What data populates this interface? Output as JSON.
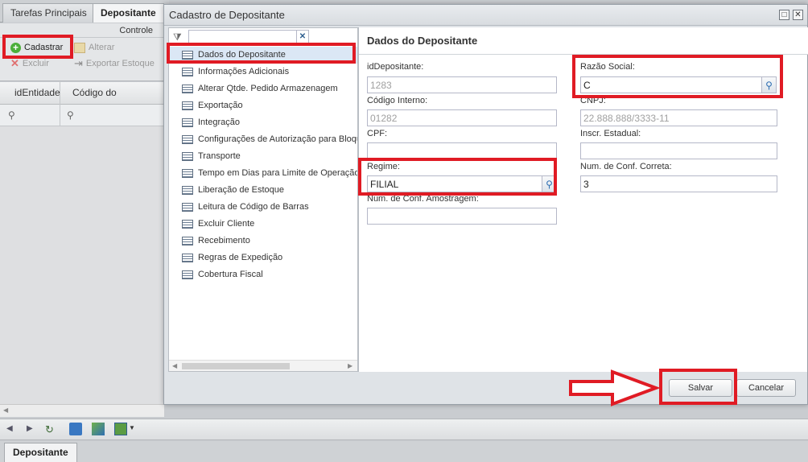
{
  "tabs": [
    {
      "label": "Tarefas Principais"
    },
    {
      "label": "Depositante"
    }
  ],
  "toolbar": {
    "group_label": "Controle",
    "cadastrar": "Cadastrar",
    "alterar": "Alterar",
    "excluir": "Excluir",
    "exportar": "Exportar Estoque"
  },
  "grid": {
    "columns": [
      "idEntidade",
      "Código do Depositante"
    ]
  },
  "bottom_tab": "Depositante",
  "modal": {
    "title": "Cadastro de Depositante",
    "menu": [
      "Dados do Depositante",
      "Informações Adicionais",
      "Alterar Qtde. Pedido Armazenagem",
      "Exportação",
      "Integração",
      "Configurações de Autorização para Bloqueio",
      "Transporte",
      "Tempo em Dias para Limite de Operação",
      "Liberação de Estoque",
      "Leitura de Código de Barras",
      "Excluir Cliente",
      "Recebimento",
      "Regras de Expedição",
      "Cobertura Fiscal"
    ],
    "selected_menu": "Dados do Depositante",
    "form": {
      "title": "Dados do Depositante",
      "idDepositante": {
        "label": "idDepositante:",
        "value": "1283"
      },
      "codigo_interno": {
        "label": "Código Interno:",
        "value": "01282"
      },
      "cpf": {
        "label": "CPF:",
        "value": ""
      },
      "regime": {
        "label": "Regime:",
        "value": "FILIAL"
      },
      "num_conf_amostragem": {
        "label": "Num. de Conf. Amostragem:",
        "value": ""
      },
      "razao_social": {
        "label": "Razão Social:",
        "value": "C"
      },
      "cnpj": {
        "label": "CNPJ:",
        "value": "22.888.888/3333-11"
      },
      "inscr_estadual": {
        "label": "Inscr. Estadual:",
        "value": ""
      },
      "num_conf_correta": {
        "label": "Num. de Conf. Correta:",
        "value": "3"
      }
    },
    "buttons": {
      "salvar": "Salvar",
      "cancelar": "Cancelar"
    }
  },
  "colors": {
    "highlight": "#e01b24",
    "accent": "#2f6fb3"
  }
}
